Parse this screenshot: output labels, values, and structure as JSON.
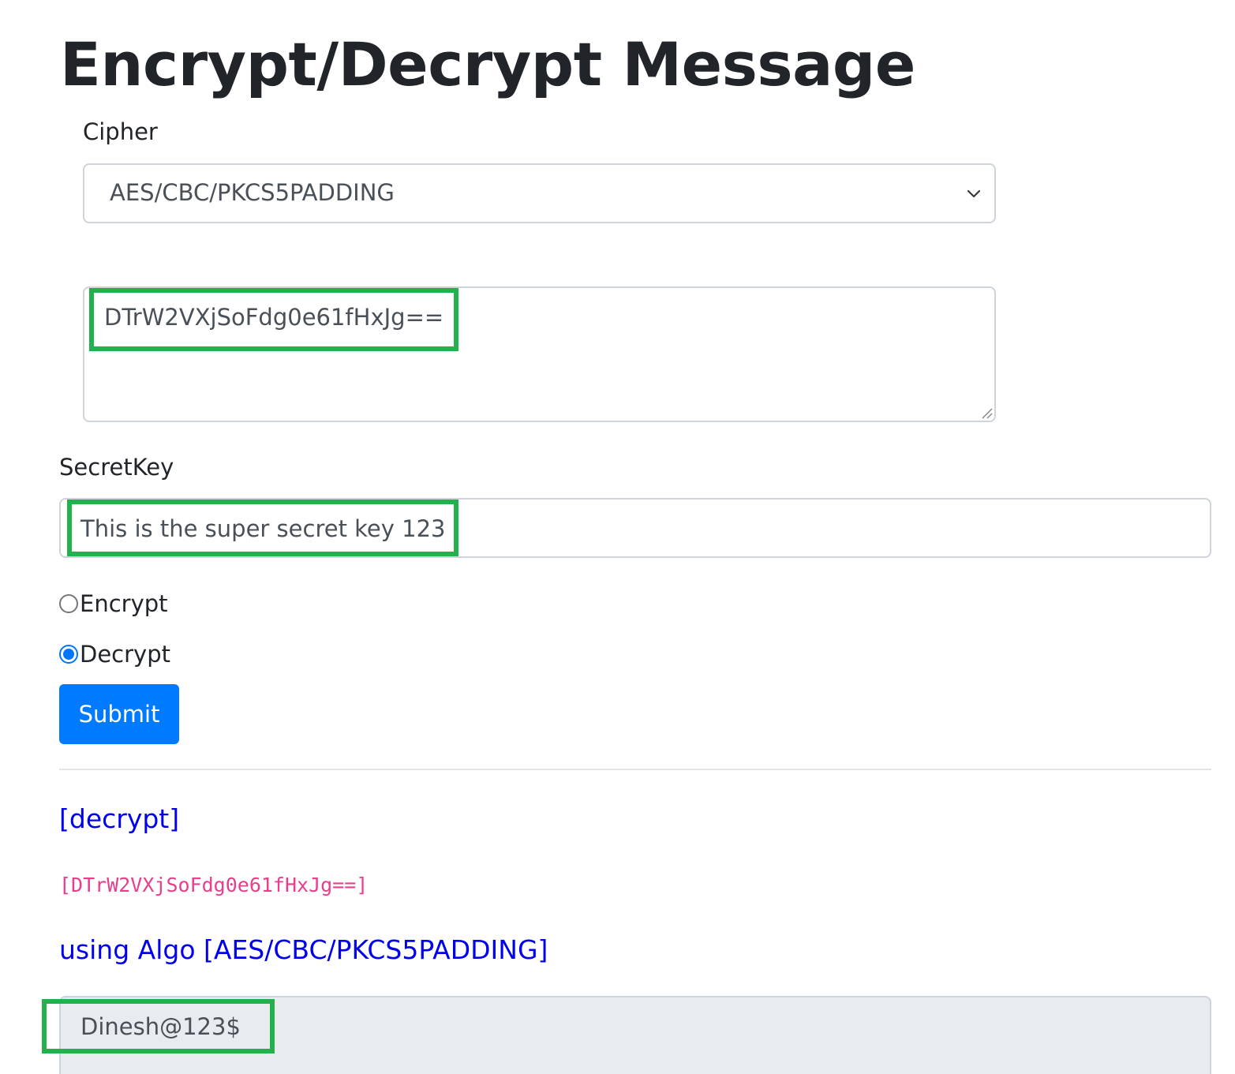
{
  "page": {
    "title": "Encrypt/Decrypt Message"
  },
  "cipher": {
    "label": "Cipher",
    "selected": "AES/CBC/PKCS5PADDING"
  },
  "message": {
    "value": "DTrW2VXjSoFdg0e61fHxJg=="
  },
  "secret_key": {
    "label": "SecretKey",
    "value": "This is the super secret key 123"
  },
  "mode": {
    "options": [
      {
        "label": "Encrypt",
        "checked": false
      },
      {
        "label": "Decrypt",
        "checked": true
      }
    ]
  },
  "submit": {
    "label": "Submit"
  },
  "result": {
    "operation": "[decrypt]",
    "input": "[DTrW2VXjSoFdg0e61fHxJg==]",
    "algo": "using Algo [AES/CBC/PKCS5PADDING]",
    "output": "Dinesh@123$"
  },
  "colors": {
    "primary": "#007bff",
    "highlight": "#22b14c",
    "link_blue": "#0000ee",
    "code_pink": "#e83e8c"
  }
}
